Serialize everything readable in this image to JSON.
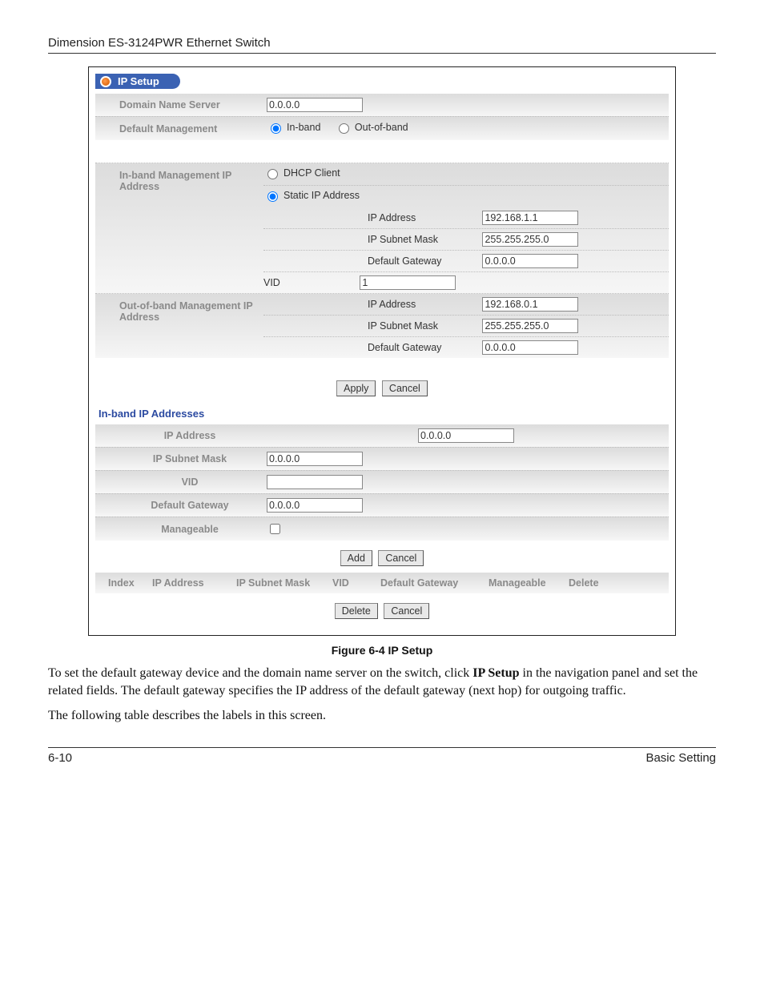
{
  "doc_header": "Dimension ES-3124PWR Ethernet Switch",
  "panel_title": "IP Setup",
  "top": {
    "dns_label": "Domain Name Server",
    "dns_value": "0.0.0.0",
    "defmgmt_label": "Default Management",
    "inband_opt": "In-band",
    "outband_opt": "Out-of-band"
  },
  "inband_mgmt": {
    "label": "In-band Management IP Address",
    "dhcp_opt": "DHCP Client",
    "static_opt": "Static IP Address",
    "ip_label": "IP Address",
    "ip_value": "192.168.1.1",
    "mask_label": "IP Subnet Mask",
    "mask_value": "255.255.255.0",
    "gw_label": "Default Gateway",
    "gw_value": "0.0.0.0",
    "vid_label": "VID",
    "vid_value": "1"
  },
  "outband_mgmt": {
    "label": "Out-of-band Management IP Address",
    "ip_label": "IP Address",
    "ip_value": "192.168.0.1",
    "mask_label": "IP Subnet Mask",
    "mask_value": "255.255.255.0",
    "gw_label": "Default Gateway",
    "gw_value": "0.0.0.0"
  },
  "buttons": {
    "apply": "Apply",
    "cancel": "Cancel",
    "add": "Add",
    "delete": "Delete"
  },
  "inband_ips": {
    "title": "In-band IP Addresses",
    "ip_label": "IP Address",
    "ip_value": "0.0.0.0",
    "mask_label": "IP Subnet Mask",
    "mask_value": "0.0.0.0",
    "vid_label": "VID",
    "vid_value": "",
    "gw_label": "Default Gateway",
    "gw_value": "0.0.0.0",
    "mgbl_label": "Manageable"
  },
  "table_head": {
    "index": "Index",
    "ip": "IP Address",
    "mask": "IP Subnet Mask",
    "vid": "VID",
    "gw": "Default Gateway",
    "mgbl": "Manageable",
    "del": "Delete"
  },
  "caption": "Figure 6-4 IP Setup",
  "para1_a": "To set the default gateway device and the domain name server on the switch, click ",
  "para1_b": "IP Setup",
  "para1_c": " in the navigation panel and set the related fields. The default gateway specifies the IP address of the default gateway (next hop) for outgoing traffic.",
  "para2": "The following table describes the labels in this screen.",
  "page_num": "6-10",
  "footer_right": "Basic Setting"
}
